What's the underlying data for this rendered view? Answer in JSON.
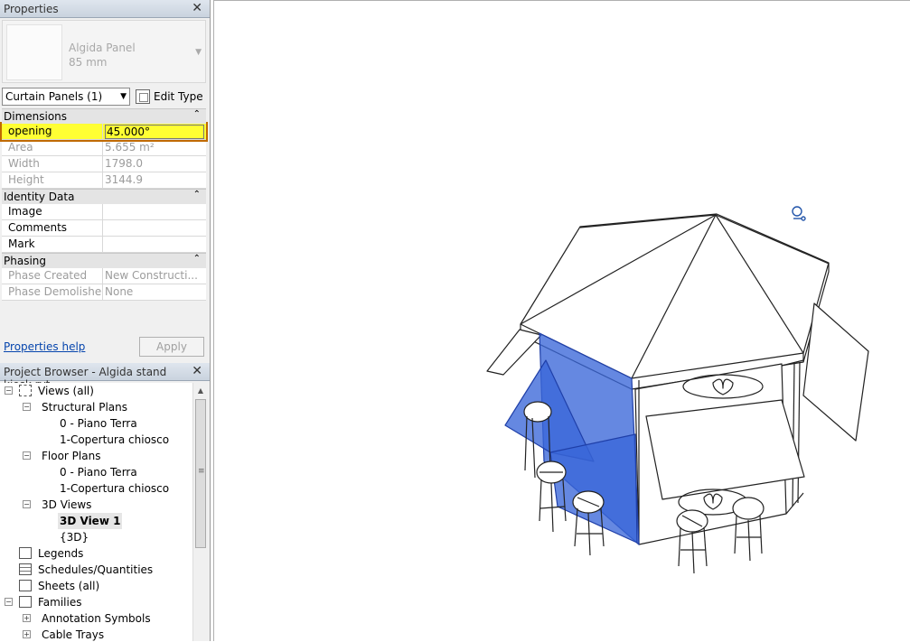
{
  "properties": {
    "title": "Properties",
    "close": "✕",
    "type_name": [
      "Algida Panel",
      "85 mm"
    ],
    "instance_selector": "Curtain Panels (1)",
    "edit_type_label": "Edit Type",
    "groups": {
      "dimensions": {
        "label": "Dimensions",
        "rows": [
          {
            "key": "opening",
            "value": "45.000°"
          },
          {
            "key": "Area",
            "value": "5.655 m²"
          },
          {
            "key": "Width",
            "value": "1798.0"
          },
          {
            "key": "Height",
            "value": "3144.9"
          }
        ]
      },
      "identity": {
        "label": "Identity Data",
        "rows": [
          {
            "key": "Image",
            "value": ""
          },
          {
            "key": "Comments",
            "value": ""
          },
          {
            "key": "Mark",
            "value": ""
          }
        ]
      },
      "phasing": {
        "label": "Phasing",
        "rows": [
          {
            "key": "Phase Created",
            "value": "New Constructi..."
          },
          {
            "key": "Phase Demolished",
            "value": "None"
          }
        ]
      }
    },
    "help_link": "Properties help",
    "apply_label": "Apply"
  },
  "project_browser": {
    "title": "Project Browser - Algida stand kiosk.rvt",
    "close": "✕",
    "nodes": [
      {
        "label": "Views (all)"
      },
      {
        "label": "Structural Plans"
      },
      {
        "label": "0 - Piano Terra"
      },
      {
        "label": "1-Copertura chiosco"
      },
      {
        "label": "Floor Plans"
      },
      {
        "label": "0 - Piano Terra"
      },
      {
        "label": "1-Copertura chiosco"
      },
      {
        "label": "3D Views"
      },
      {
        "label": "3D View 1"
      },
      {
        "label": "{3D}"
      },
      {
        "label": "Legends"
      },
      {
        "label": "Schedules/Quantities"
      },
      {
        "label": "Sheets (all)"
      },
      {
        "label": "Families"
      },
      {
        "label": "Annotation Symbols"
      },
      {
        "label": "Cable Trays"
      }
    ]
  },
  "viewport": {
    "selection_color": "#3a66d8"
  }
}
